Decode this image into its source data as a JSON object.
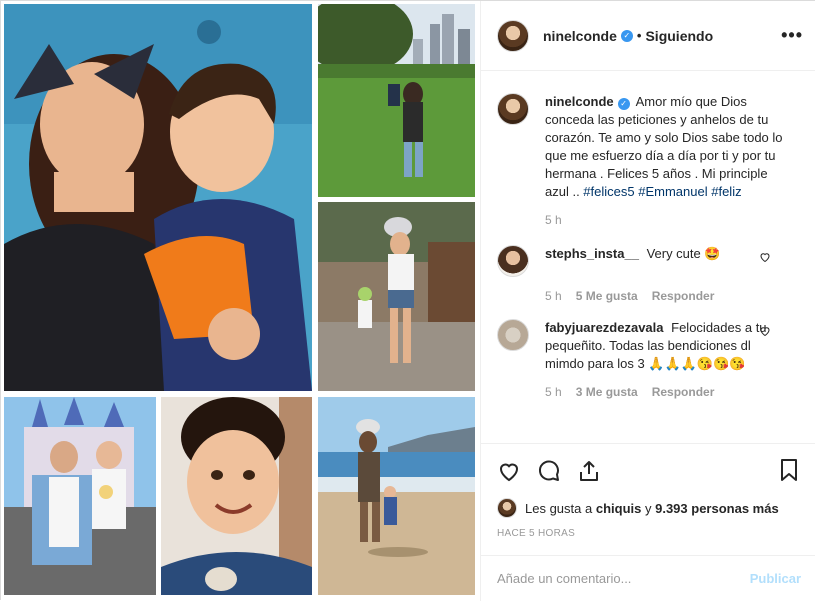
{
  "header": {
    "username": "ninelconde",
    "separator": "•",
    "follow_label": "Siguiendo",
    "more_label": "•••"
  },
  "caption": {
    "username": "ninelconde",
    "text": "Amor mío que Dios conceda las peticiones y anhelos de tu corazón. Te amo y solo Dios sabe todo lo que me esfuerzo día a día por ti y por tu hermana . Felices 5 años . Mi principle azul .. ",
    "hashtags": [
      "#felices5",
      "#Emmanuel",
      "#feliz"
    ],
    "time": "5 h"
  },
  "comments": [
    {
      "username": "stephs_insta__",
      "text": "Very cute 🤩",
      "time": "5 h",
      "likes": "5 Me gusta",
      "reply": "Responder"
    },
    {
      "username": "fabyjuarezdezavala",
      "text": "Felocidades a tu pequeñito. Todas las bendiciones dl mimdo para los 3 🙏🙏🙏😘😘😘",
      "time": "5 h",
      "likes": "3 Me gusta",
      "reply": "Responder"
    }
  ],
  "likes": {
    "prefix": "Les gusta a",
    "user": "chiquis",
    "connector": "y",
    "count": "9.393 personas más"
  },
  "timestamp": "HACE 5 HORAS",
  "add_comment": {
    "placeholder": "Añade un comentario...",
    "publish_label": "Publicar"
  },
  "icons": {
    "like": "heart-icon",
    "comment": "comment-icon",
    "share": "share-icon",
    "save": "bookmark-icon",
    "verified": "verified-badge-icon"
  },
  "colors": {
    "verified": "#3897f0",
    "link": "#003569",
    "muted": "#999999",
    "publish_disabled": "#b2dffc"
  }
}
